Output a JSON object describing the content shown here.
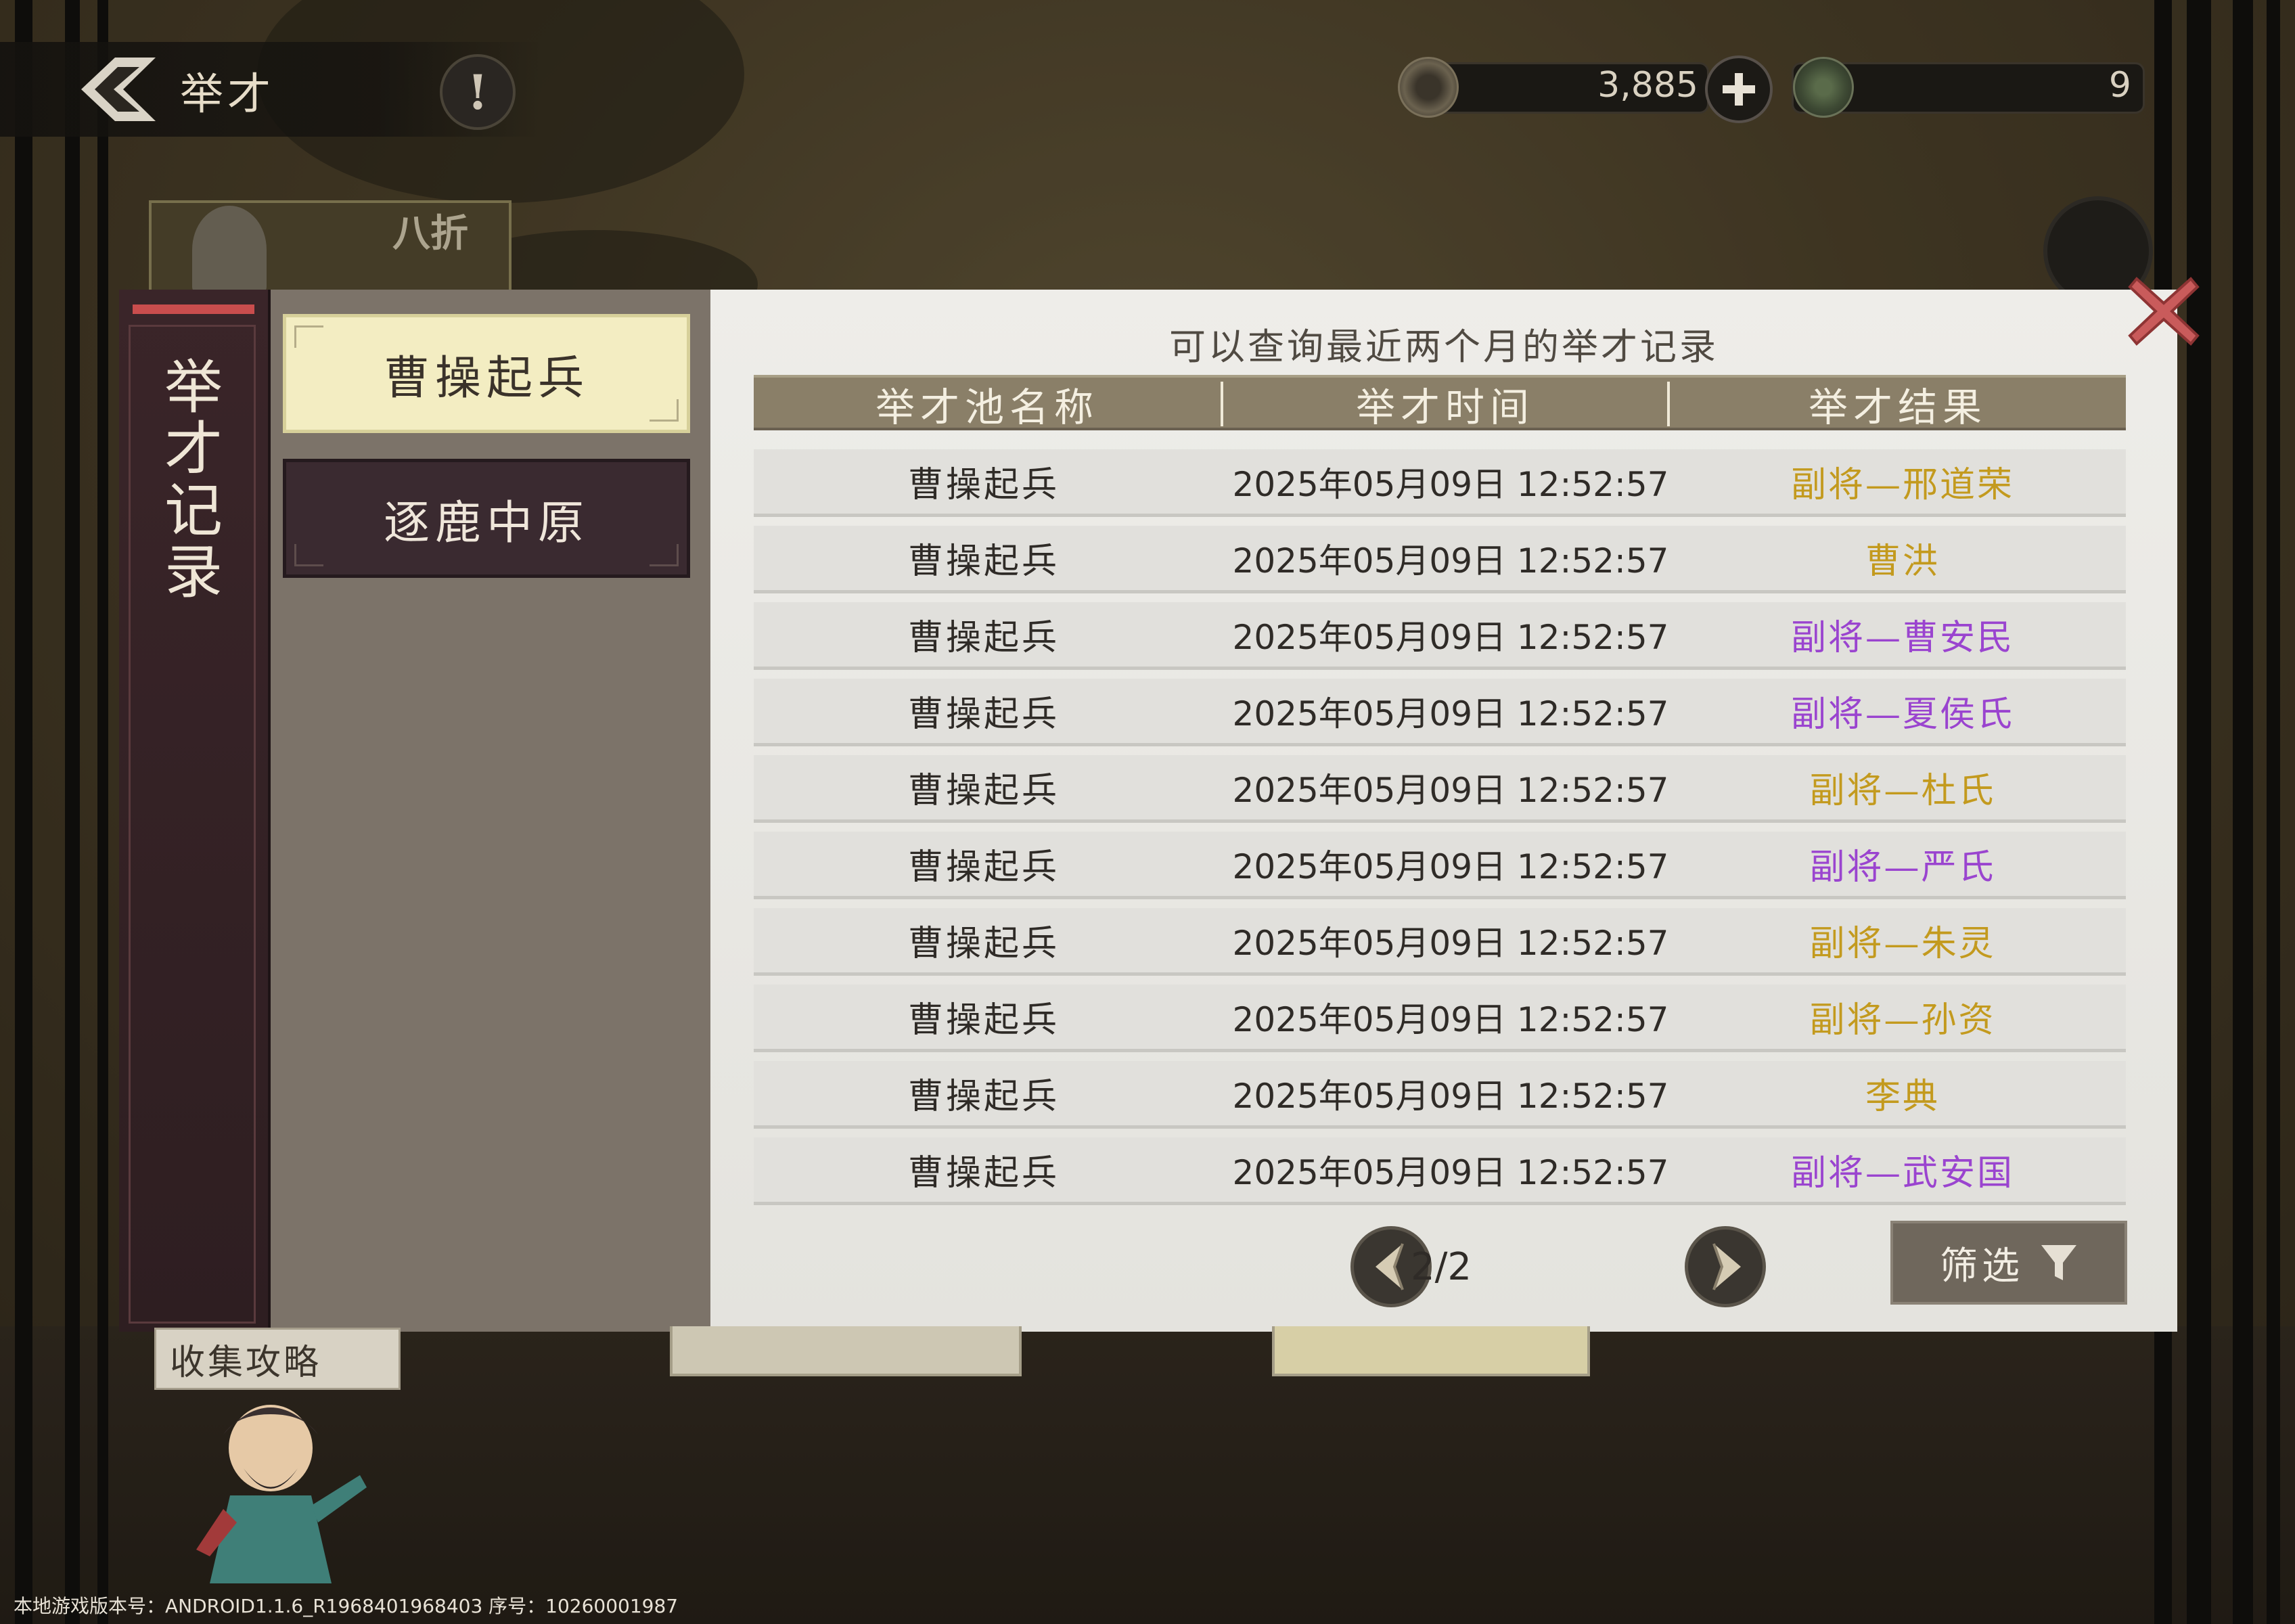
{
  "header": {
    "title": "举才",
    "info_label": "!"
  },
  "currencies": {
    "coins": "3,885",
    "tokens": "9"
  },
  "background": {
    "discount_tag": "八折",
    "guide_label": "收集攻略"
  },
  "modal": {
    "spine_title": "举才记录",
    "tabs": [
      {
        "label": "曹操起兵",
        "active": true
      },
      {
        "label": "逐鹿中原",
        "active": false
      }
    ],
    "notice": "可以查询最近两个月的举才记录",
    "columns": [
      "举才池名称",
      "举才时间",
      "举才结果"
    ],
    "rows": [
      {
        "pool": "曹操起兵",
        "time": "2025年05月09日 12:52:57",
        "result": "副将—邢道荣",
        "color": "#c39a1e"
      },
      {
        "pool": "曹操起兵",
        "time": "2025年05月09日 12:52:57",
        "result": "曹洪",
        "color": "#c39a1e"
      },
      {
        "pool": "曹操起兵",
        "time": "2025年05月09日 12:52:57",
        "result": "副将—曹安民",
        "color": "#9a44cf"
      },
      {
        "pool": "曹操起兵",
        "time": "2025年05月09日 12:52:57",
        "result": "副将—夏侯氏",
        "color": "#9a44cf"
      },
      {
        "pool": "曹操起兵",
        "time": "2025年05月09日 12:52:57",
        "result": "副将—杜氏",
        "color": "#c39a1e"
      },
      {
        "pool": "曹操起兵",
        "time": "2025年05月09日 12:52:57",
        "result": "副将—严氏",
        "color": "#9a44cf"
      },
      {
        "pool": "曹操起兵",
        "time": "2025年05月09日 12:52:57",
        "result": "副将—朱灵",
        "color": "#c39a1e"
      },
      {
        "pool": "曹操起兵",
        "time": "2025年05月09日 12:52:57",
        "result": "副将—孙资",
        "color": "#c39a1e"
      },
      {
        "pool": "曹操起兵",
        "time": "2025年05月09日 12:52:57",
        "result": "李典",
        "color": "#c39a1e"
      },
      {
        "pool": "曹操起兵",
        "time": "2025年05月09日 12:52:57",
        "result": "副将—武安国",
        "color": "#9a44cf"
      }
    ],
    "pagination": "2/2",
    "filter_label": "筛选"
  },
  "footer": {
    "version": "本地游戏版本号：ANDROID1.1.6_R1968401968403 序号：10260001987"
  },
  "icons": {
    "back": "back-arrow-icon",
    "close": "close-x-icon",
    "prev": "prev-arrow-icon",
    "next": "next-arrow-icon",
    "filter": "funnel-icon",
    "coin": "coin-icon",
    "token": "jade-token-icon"
  }
}
